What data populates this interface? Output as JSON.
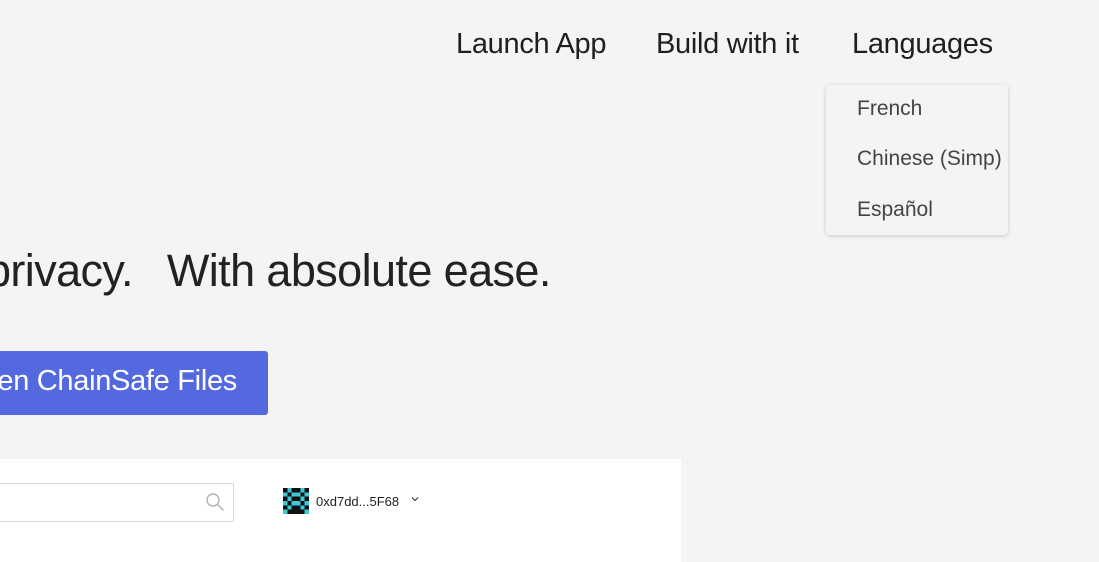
{
  "nav": {
    "launch_app": "Launch App",
    "build_with_it": "Build with it",
    "languages": "Languages"
  },
  "languages_menu": {
    "items": [
      "French",
      "Chinese (Simp)",
      "Español"
    ]
  },
  "hero": {
    "line_part1": "privacy.",
    "line_part2": "With absolute ease.",
    "cta_label": "en ChainSafe Files"
  },
  "preview": {
    "search_icon": "search-icon",
    "wallet_address": "0xd7dd...5F68",
    "chevron_icon": "chevron-down-icon",
    "avatar_icon": "identicon-avatar"
  },
  "colors": {
    "background": "#f4f4f4",
    "accent": "#5469e0",
    "text": "#222222",
    "avatar_primary": "#3ec8d6",
    "avatar_secondary": "#111111"
  }
}
